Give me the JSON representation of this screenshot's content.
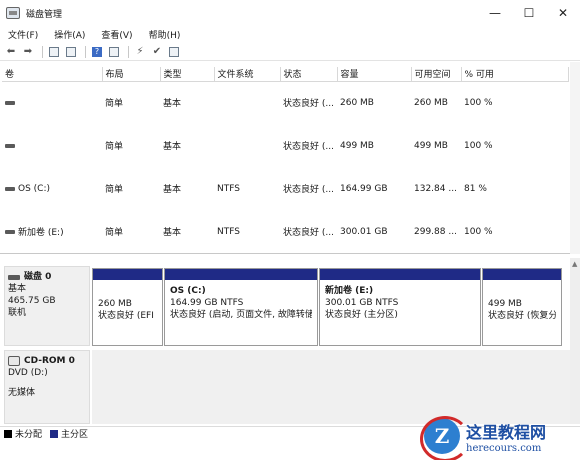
{
  "window": {
    "title": "磁盘管理",
    "controls": [
      "—",
      "☐",
      "✕"
    ]
  },
  "menu": [
    "文件(F)",
    "操作(A)",
    "查看(V)",
    "帮助(H)"
  ],
  "toolbar": {
    "icons": [
      "back-arrow-icon",
      "forward-arrow-icon",
      "properties-icon",
      "grid-icon",
      "help-icon",
      "grid-alt-icon",
      "connect-icon",
      "check-icon",
      "window-icon"
    ]
  },
  "volume_table": {
    "columns": [
      "卷",
      "布局",
      "类型",
      "文件系统",
      "状态",
      "容量",
      "可用空间",
      "% 可用"
    ],
    "rows": [
      {
        "volume": "",
        "layout": "简单",
        "type": "基本",
        "fs": "",
        "status": "状态良好 (...",
        "capacity": "260 MB",
        "free": "260 MB",
        "pct": "100 %"
      },
      {
        "volume": "",
        "layout": "简单",
        "type": "基本",
        "fs": "",
        "status": "状态良好 (...",
        "capacity": "499 MB",
        "free": "499 MB",
        "pct": "100 %"
      },
      {
        "volume": "OS (C:)",
        "layout": "简单",
        "type": "基本",
        "fs": "NTFS",
        "status": "状态良好 (...",
        "capacity": "164.99 GB",
        "free": "132.84 ...",
        "pct": "81 %"
      },
      {
        "volume": "新加卷 (E:)",
        "layout": "简单",
        "type": "基本",
        "fs": "NTFS",
        "status": "状态良好 (...",
        "capacity": "300.01 GB",
        "free": "299.88 ...",
        "pct": "100 %"
      }
    ]
  },
  "disk0": {
    "name": "磁盘 0",
    "type": "基本",
    "size": "465.75 GB",
    "state": "联机",
    "partitions": [
      {
        "label": "",
        "size": "260 MB",
        "status": "状态良好 (EFI"
      },
      {
        "label": "OS  (C:)",
        "size": "164.99 GB NTFS",
        "status": "状态良好 (启动, 页面文件, 故障转储"
      },
      {
        "label": "新加卷  (E:)",
        "size": "300.01 GB NTFS",
        "status": "状态良好 (主分区)"
      },
      {
        "label": "",
        "size": "499 MB",
        "status": "状态良好 (恢复分"
      }
    ]
  },
  "cdrom0": {
    "name": "CD-ROM 0",
    "drive": "DVD (D:)",
    "state": "无媒体"
  },
  "legend": [
    {
      "label": "未分配",
      "color": "#000000"
    },
    {
      "label": "主分区",
      "color": "#1f2a86"
    }
  ],
  "watermark": {
    "logo_letter": "Z",
    "title": "这里教程网",
    "url": "herecours.com"
  }
}
